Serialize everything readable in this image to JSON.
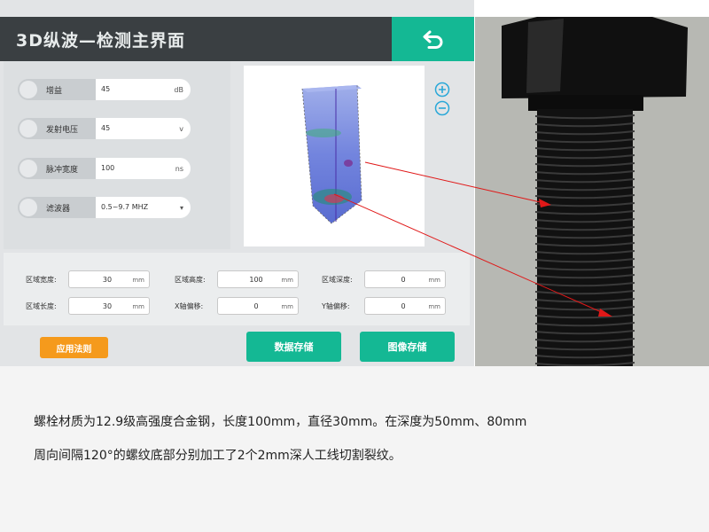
{
  "header": {
    "title": "3D纵波—检测主界面",
    "back_icon": "undo-arrow-icon"
  },
  "params": [
    {
      "label": "增益",
      "value": "45",
      "unit": "dB"
    },
    {
      "label": "发射电压",
      "value": "45",
      "unit": "v"
    },
    {
      "label": "脉冲宽度",
      "value": "100",
      "unit": "ns"
    },
    {
      "label": "滤波器",
      "value": "0.5~9.7 MHZ",
      "unit": "▾"
    }
  ],
  "zoom": {
    "in_icon": "zoom-in-icon",
    "out_icon": "zoom-out-icon"
  },
  "region": [
    {
      "label": "区域宽度:",
      "value": "30",
      "unit": "mm"
    },
    {
      "label": "区域高度:",
      "value": "100",
      "unit": "mm"
    },
    {
      "label": "区域深度:",
      "value": "0",
      "unit": "mm"
    },
    {
      "label": "区域长度:",
      "value": "30",
      "unit": "mm"
    },
    {
      "label": "X轴偏移:",
      "value": "0",
      "unit": "mm"
    },
    {
      "label": "Y轴偏移:",
      "value": "0",
      "unit": "mm"
    }
  ],
  "buttons": {
    "apply_rule": "应用法则",
    "save_data": "数据存储",
    "save_image": "图像存储"
  },
  "caption": {
    "line1": "螺栓材质为12.9级高强度合金钢，长度100mm，直径30mm。在深度为50mm、80mm",
    "line2": "周向间隔120°的螺纹底部分别加工了2个2mm深人工线切割裂纹。"
  },
  "colors": {
    "accent": "#14b894",
    "title_bar": "#3a3f42",
    "apply_button": "#f59a1c",
    "zoom": "#2aa8d8",
    "arrow": "#e01818"
  }
}
